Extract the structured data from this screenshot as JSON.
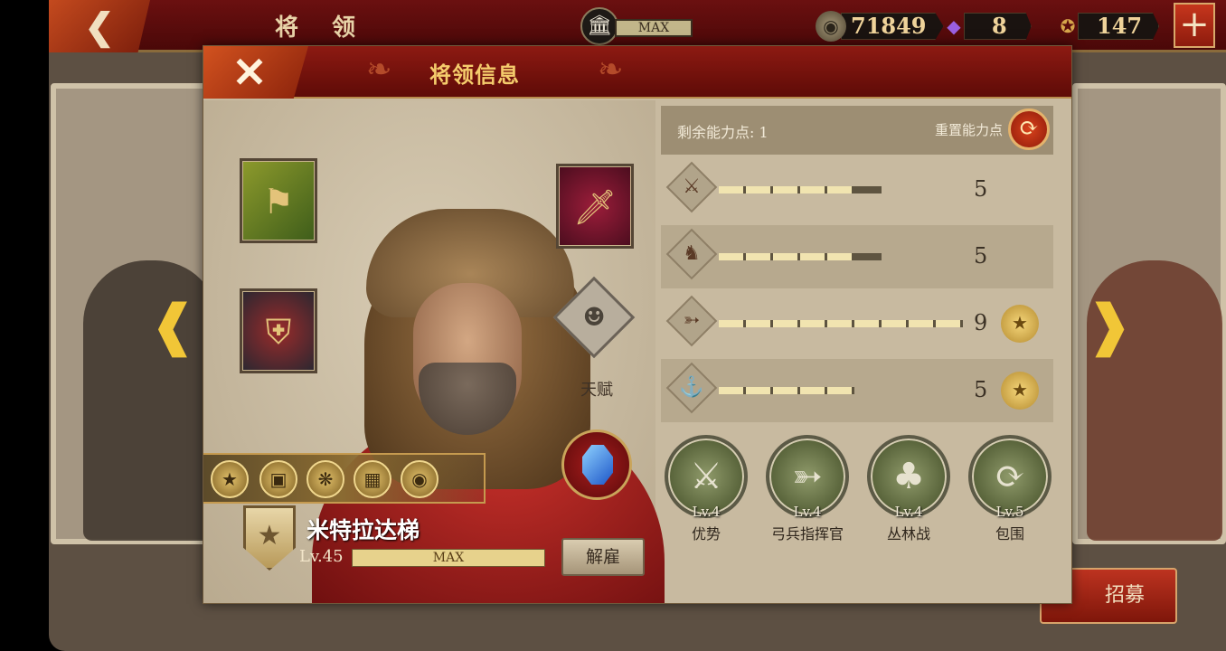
{
  "topbar": {
    "back_icon": "back-chevron-icon",
    "title": "将 领",
    "temple_level": "MAX",
    "coins": "71849",
    "gems": "8",
    "badges": "147",
    "plus_label": "+"
  },
  "dialog": {
    "close_label": "✕",
    "title": "将领信息",
    "remaining_points_label": "剩余能力点: 1",
    "reset_label": "重置能力点",
    "talent_label": "天赋",
    "hero": {
      "name": "米特拉达梯",
      "level": "Lv.45",
      "level_bar": "MAX",
      "dismiss": "解雇"
    },
    "stats": [
      {
        "icon": "sword-icon",
        "value": "5",
        "fill_segments": 5,
        "total_segments": 6,
        "badge": false
      },
      {
        "icon": "horse-icon",
        "value": "5",
        "fill_segments": 5,
        "total_segments": 6,
        "badge": false
      },
      {
        "icon": "bow-icon",
        "value": "9",
        "fill_segments": 9,
        "total_segments": 9,
        "badge": true
      },
      {
        "icon": "anchor-icon",
        "value": "5",
        "fill_segments": 5,
        "total_segments": 5,
        "badge": true
      }
    ],
    "skills": [
      {
        "level": "Lv.4",
        "name": "优势"
      },
      {
        "level": "Lv.4",
        "name": "弓兵指挥官"
      },
      {
        "level": "Lv.4",
        "name": "丛林战"
      },
      {
        "level": "Lv.5",
        "name": "包围"
      }
    ]
  },
  "recruit_label": "招募",
  "colors": {
    "header_red": "#6b1010",
    "panel_bg": "#c8baa0",
    "gold": "#f5cc6c"
  }
}
